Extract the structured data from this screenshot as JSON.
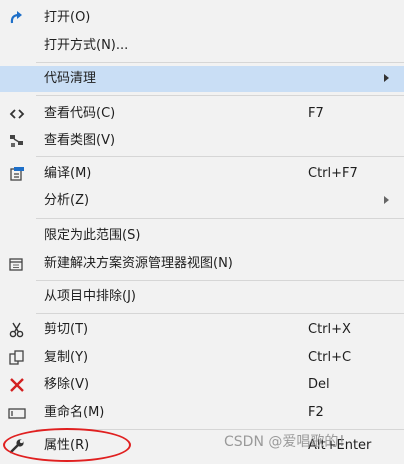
{
  "menu": {
    "items": [
      {
        "label": "打开(O)",
        "icon": "redo-arrow-icon"
      },
      {
        "label": "打开方式(N)..."
      },
      {
        "label": "代码清理",
        "submenu": true,
        "highlighted": true
      },
      {
        "label": "查看代码(C)",
        "shortcut": "F7",
        "icon": "code-brackets-icon"
      },
      {
        "label": "查看类图(V)",
        "icon": "class-diagram-icon"
      },
      {
        "label": "编译(M)",
        "shortcut": "Ctrl+F7",
        "icon": "build-icon"
      },
      {
        "label": "分析(Z)",
        "submenu": true
      },
      {
        "label": "限定为此范围(S)"
      },
      {
        "label": "新建解决方案资源管理器视图(N)",
        "icon": "new-window-icon"
      },
      {
        "label": "从项目中排除(J)"
      },
      {
        "label": "剪切(T)",
        "shortcut": "Ctrl+X",
        "icon": "scissors-icon"
      },
      {
        "label": "复制(Y)",
        "shortcut": "Ctrl+C",
        "icon": "copy-icon"
      },
      {
        "label": "移除(V)",
        "shortcut": "Del",
        "icon": "red-x-icon"
      },
      {
        "label": "重命名(M)",
        "shortcut": "F2",
        "icon": "rename-icon"
      },
      {
        "label": "属性(R)",
        "shortcut": "Alt+Enter",
        "icon": "wrench-icon"
      }
    ]
  },
  "watermark": "CSDN @爱唱歌的！",
  "colors": {
    "highlight": "#c9def5",
    "accent_blue": "#1e6fc8",
    "remove_red": "#d32020",
    "annotation_red": "#e02020"
  }
}
